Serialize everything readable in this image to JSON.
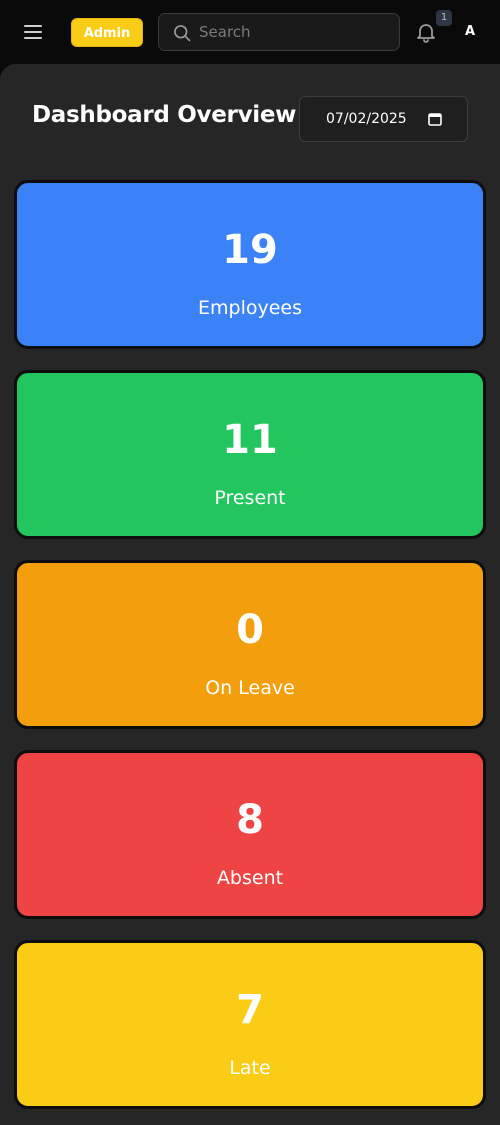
{
  "header": {
    "role_badge": "Admin",
    "search_placeholder": "Search",
    "notification_count": "1",
    "avatar_initial": "A"
  },
  "page": {
    "title": "Dashboard Overview",
    "date": "07/02/2025"
  },
  "stats": [
    {
      "value": "19",
      "label": "Employees",
      "color": "#3b82f6"
    },
    {
      "value": "11",
      "label": "Present",
      "color": "#22c55e"
    },
    {
      "value": "0",
      "label": "On Leave",
      "color": "#f29e0d"
    },
    {
      "value": "8",
      "label": "Absent",
      "color": "#ef4444"
    },
    {
      "value": "7",
      "label": "Late",
      "color": "#facc15"
    }
  ],
  "icons": {
    "menu": "menu-icon",
    "search": "search-icon",
    "bell": "bell-icon",
    "calendar": "calendar-icon"
  }
}
